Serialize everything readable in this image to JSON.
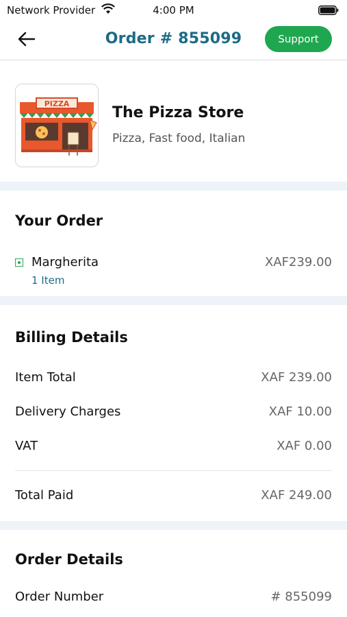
{
  "status_bar": {
    "carrier": "Network Provider",
    "time": "4:00 PM"
  },
  "header": {
    "title": "Order # 855099",
    "support_label": "Support"
  },
  "store": {
    "name": "The Pizza Store",
    "cuisine": "Pizza, Fast food, Italian",
    "sign_text": "PIZZA"
  },
  "your_order": {
    "title": "Your Order",
    "items": [
      {
        "name": "Margherita",
        "quantity": "1 Item",
        "price": "XAF239.00"
      }
    ]
  },
  "billing": {
    "title": "Billing Details",
    "rows": [
      {
        "label": "Item Total",
        "value": "XAF 239.00"
      },
      {
        "label": "Delivery Charges",
        "value": "XAF 10.00"
      },
      {
        "label": "VAT",
        "value": "XAF 0.00"
      }
    ],
    "total": {
      "label": "Total Paid",
      "value": "XAF 249.00"
    }
  },
  "order_details": {
    "title": "Order Details",
    "rows": [
      {
        "label": "Order Number",
        "value": "# 855099"
      }
    ]
  },
  "colors": {
    "accent": "#1c6b86",
    "support": "#1fa74f",
    "veg_marker": "#2fa55a",
    "band": "#eef3f9"
  },
  "icons": {
    "back": "arrow-left-icon",
    "wifi": "wifi-icon",
    "battery": "battery-icon",
    "veg": "veg-marker-icon"
  }
}
